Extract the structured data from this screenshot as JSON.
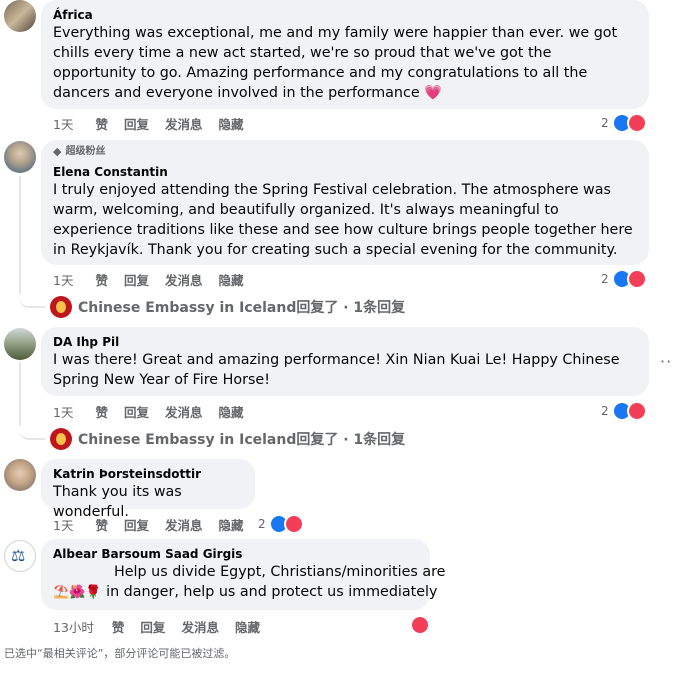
{
  "comments": [
    {
      "author": "África",
      "text": "Everything was exceptional, me and my family were happier than ever. we got chills every time a new act started, we're so proud that we've got the opportunity to go. Amazing performance and my congratulations to all the dancers and everyone involved in the performance 💗",
      "time": "1天",
      "like": "赞",
      "reply": "回复",
      "message": "发消息",
      "hide": "隐藏",
      "reaction_count": "2",
      "avatar": "nature-photo"
    },
    {
      "badge": "超级粉丝",
      "author": "Elena Constantin",
      "text": "I truly enjoyed attending the Spring Festival celebration. The atmosphere was warm, welcoming, and beautifully organized. It's always meaningful to experience traditions like these and see how culture brings people together here in Reykjavík. Thank you for creating such a special evening for the community.",
      "time": "1天",
      "like": "赞",
      "reply": "回复",
      "message": "发消息",
      "hide": "隐藏",
      "reaction_count": "2",
      "reply_summary": "Chinese Embassy in Iceland回复了 · 1条回复",
      "avatar": "portrait"
    },
    {
      "author": "DA Ihp Pil",
      "text": "I was there! Great and amazing performance! Xin Nian Kuai Le! Happy Chinese Spring New Year of Fire Horse!",
      "time": "1天",
      "like": "赞",
      "reply": "回复",
      "message": "发消息",
      "hide": "隐藏",
      "reaction_count": "2",
      "reply_summary": "Chinese Embassy in Iceland回复了 · 1条回复",
      "more": "···",
      "avatar": "landscape"
    },
    {
      "author": "Katrin Þorsteinsdottir",
      "text": "Thank you its was wonderful.",
      "time": "1天",
      "like": "赞",
      "reply": "回复",
      "message": "发消息",
      "hide": "隐藏",
      "reaction_count": "2",
      "avatar": "portrait"
    },
    {
      "author": "Albear Barsoum Saad Girgis",
      "text_line1": "Help us divide Egypt, Christians/minorities are",
      "emoji": "⛱️🌺🌹",
      "text_line2": "in danger, help us and protect us immediately",
      "time": "13小时",
      "like": "赞",
      "reply": "回复",
      "message": "发消息",
      "hide": "隐藏",
      "avatar": "emblem"
    }
  ],
  "footer": "已选中“最相关评论”，部分评论可能已被过滤。",
  "colors": {
    "like": "#1877f2",
    "love": "#f33e58",
    "bubble": "#f0f2f5",
    "muted": "#65676b"
  }
}
